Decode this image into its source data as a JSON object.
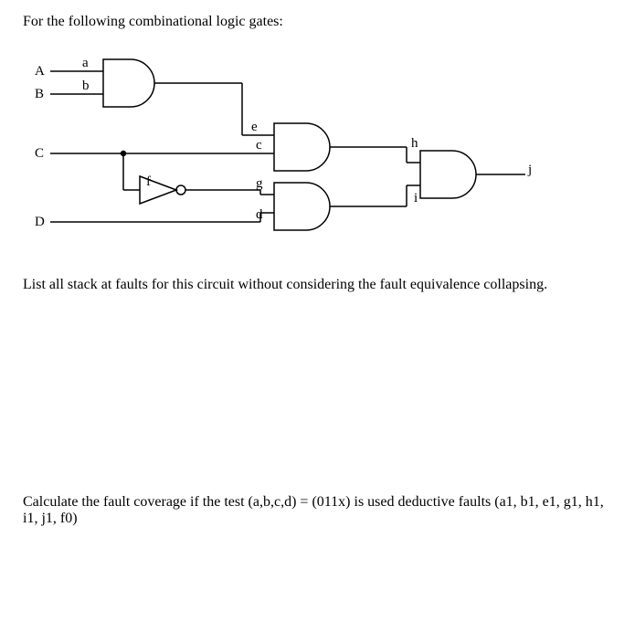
{
  "intro": "For the following combinational logic gates:",
  "labels": {
    "A": "A",
    "B": "B",
    "C": "C",
    "D": "D",
    "a": "a",
    "b": "b",
    "c": "c",
    "d": "d",
    "e": "e",
    "f": "f",
    "g": "g",
    "h": "h",
    "i": "i",
    "j": "j"
  },
  "question1": "List all stack at faults for this circuit without considering the fault equivalence collapsing.",
  "question2": "Calculate the fault coverage if the test (a,b,c,d) = (011x) is used deductive faults (a1, b1, e1, g1, h1, i1, j1, f0)"
}
